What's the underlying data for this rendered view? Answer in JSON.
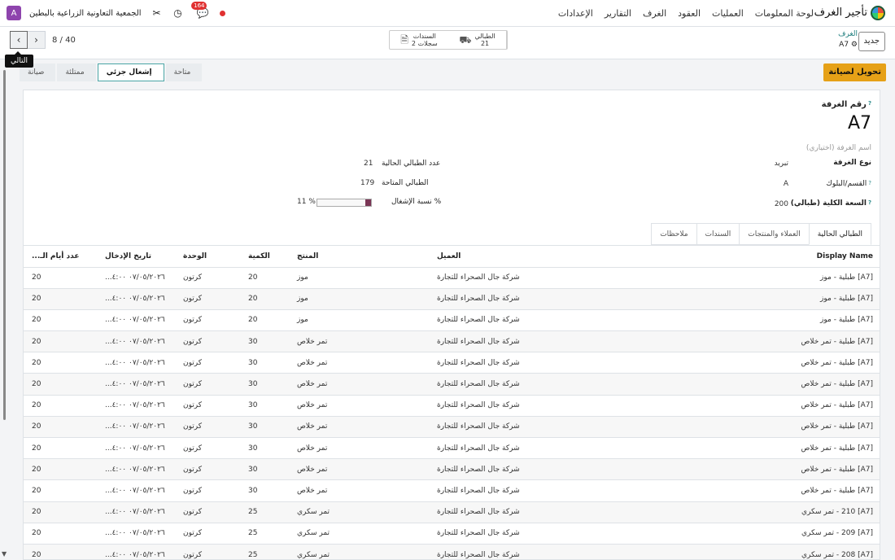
{
  "navbar": {
    "app_name": "تأجير الغرف",
    "menu": [
      "لوحة المعلومات",
      "العمليات",
      "العقود",
      "الغرف",
      "التقارير",
      "الإعدادات"
    ],
    "company": "الجمعية التعاونية الزراعية بالبطين",
    "avatar_letter": "A",
    "message_count": "164"
  },
  "control": {
    "new_button": "جديد",
    "breadcrumb_parent": "الغرف",
    "breadcrumb_current": "A7",
    "smart_buttons": [
      {
        "label": "الطبالي",
        "value": "21"
      },
      {
        "label": "السندات",
        "value": "2 سجلات"
      }
    ],
    "pager_value": "8 / 40",
    "tooltip": "التالي"
  },
  "actions": {
    "maintenance_button": "تحويل لصيانة",
    "status_steps": [
      "متاحة",
      "إشغال جزئي",
      "ممتلئة",
      "صيانة"
    ],
    "active_status": "إشغال جزئي"
  },
  "form": {
    "room_number_label": "رقم الغرفة",
    "room_number": "A7",
    "room_name_placeholder": "اسم الغرفة (اختياري)",
    "room_type_label": "نوع الغرفة",
    "room_type": "تبريد",
    "section_label": "القسم/البلوك",
    "section": "A",
    "capacity_label": "السعة الكلية (طبالي)",
    "capacity": "200",
    "current_pallets_label": "عدد الطبالي الحالية",
    "current_pallets": "21",
    "available_pallets_label": "الطبالي المتاحة",
    "available_pallets": "179",
    "occupancy_label": "نسبة الإشغال %",
    "occupancy_value": "11 %",
    "occupancy_fraction": 0.11
  },
  "tabs": [
    "الطبالي الحالية",
    "العملاء والمنتجات",
    "السندات",
    "ملاحظات"
  ],
  "table": {
    "headers": [
      "Display Name",
      "العميل",
      "المنتج",
      "الكمية",
      "الوحدة",
      "تاريخ الإدخال",
      "عدد أيام الـ..."
    ],
    "rows": [
      [
        "[A7] طبلية - موز",
        "شركة جال الصحراء للتجارة",
        "موز",
        "20",
        "كرتون",
        "٠٧/٠٥/٢٠٢٦ ٤:٠٠...",
        "20"
      ],
      [
        "[A7] طبلية - موز",
        "شركة جال الصحراء للتجارة",
        "موز",
        "20",
        "كرتون",
        "٠٧/٠٥/٢٠٢٦ ٤:٠٠...",
        "20"
      ],
      [
        "[A7] طبلية - موز",
        "شركة جال الصحراء للتجارة",
        "موز",
        "20",
        "كرتون",
        "٠٧/٠٥/٢٠٢٦ ٤:٠٠...",
        "20"
      ],
      [
        "[A7] طبلية - تمر خلاص",
        "شركة جال الصحراء للتجارة",
        "تمر خلاص",
        "30",
        "كرتون",
        "٠٧/٠٥/٢٠٢٦ ٤:٠٠...",
        "20"
      ],
      [
        "[A7] طبلية - تمر خلاص",
        "شركة جال الصحراء للتجارة",
        "تمر خلاص",
        "30",
        "كرتون",
        "٠٧/٠٥/٢٠٢٦ ٤:٠٠...",
        "20"
      ],
      [
        "[A7] طبلية - تمر خلاص",
        "شركة جال الصحراء للتجارة",
        "تمر خلاص",
        "30",
        "كرتون",
        "٠٧/٠٥/٢٠٢٦ ٤:٠٠...",
        "20"
      ],
      [
        "[A7] طبلية - تمر خلاص",
        "شركة جال الصحراء للتجارة",
        "تمر خلاص",
        "30",
        "كرتون",
        "٠٧/٠٥/٢٠٢٦ ٤:٠٠...",
        "20"
      ],
      [
        "[A7] طبلية - تمر خلاص",
        "شركة جال الصحراء للتجارة",
        "تمر خلاص",
        "30",
        "كرتون",
        "٠٧/٠٥/٢٠٢٦ ٤:٠٠...",
        "20"
      ],
      [
        "[A7] طبلية - تمر خلاص",
        "شركة جال الصحراء للتجارة",
        "تمر خلاص",
        "30",
        "كرتون",
        "٠٧/٠٥/٢٠٢٦ ٤:٠٠...",
        "20"
      ],
      [
        "[A7] طبلية - تمر خلاص",
        "شركة جال الصحراء للتجارة",
        "تمر خلاص",
        "30",
        "كرتون",
        "٠٧/٠٥/٢٠٢٦ ٤:٠٠...",
        "20"
      ],
      [
        "[A7] طبلية - تمر خلاص",
        "شركة جال الصحراء للتجارة",
        "تمر خلاص",
        "30",
        "كرتون",
        "٠٧/٠٥/٢٠٢٦ ٤:٠٠...",
        "20"
      ],
      [
        "[A7] 210 - تمر سكري",
        "شركة جال الصحراء للتجارة",
        "تمر سكري",
        "25",
        "كرتون",
        "٠٧/٠٥/٢٠٢٦ ٤:٠٠...",
        "20"
      ],
      [
        "[A7] 209 - تمر سكري",
        "شركة جال الصحراء للتجارة",
        "تمر سكري",
        "25",
        "كرتون",
        "٠٧/٠٥/٢٠٢٦ ٤:٠٠...",
        "20"
      ],
      [
        "[A7] 208 - تمر سكري",
        "شركة جال الصحراء للتجارة",
        "تمر سكري",
        "25",
        "كرتون",
        "٠٧/٠٥/٢٠٢٦ ٤:٠٠...",
        "20"
      ]
    ]
  },
  "colors": {
    "primary": "#7a3555",
    "accent": "#e6a117",
    "link": "#1c7c7c",
    "badge": "#e03131"
  }
}
